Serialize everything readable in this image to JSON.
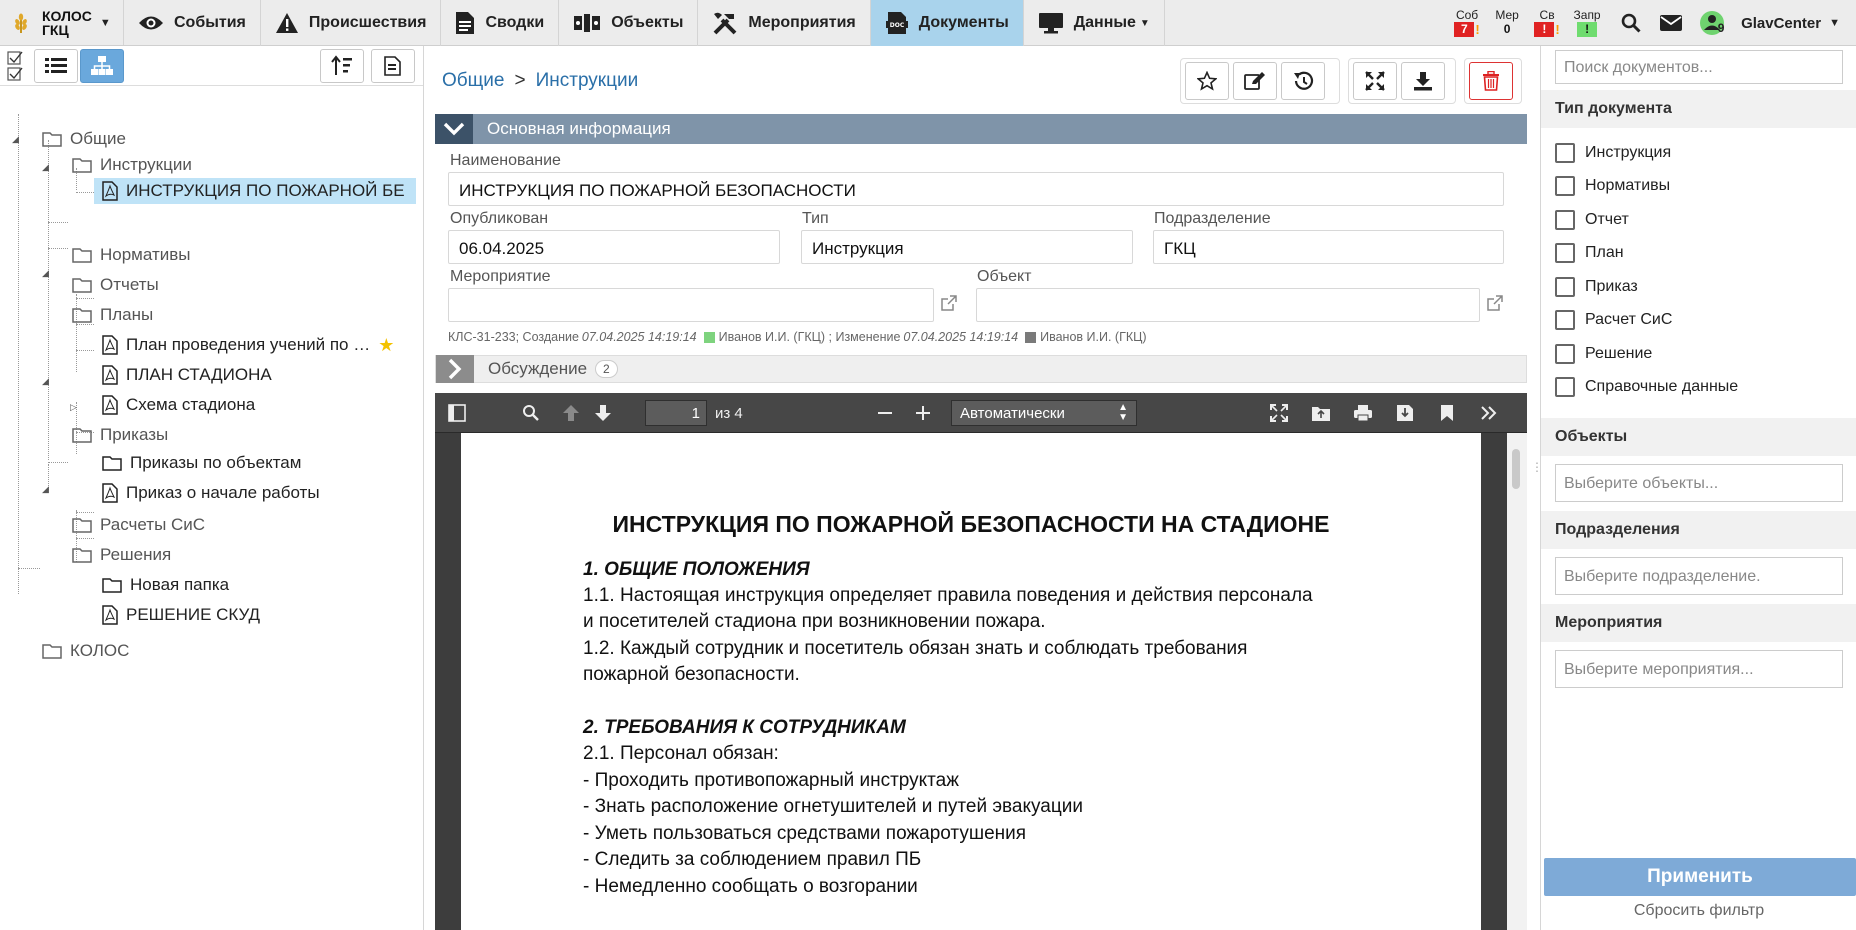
{
  "brand": {
    "line1": "КОЛОС",
    "line2": "ГКЦ"
  },
  "nav": [
    {
      "label": "События",
      "icon": "eye-icon"
    },
    {
      "label": "Происшествия",
      "icon": "warning-icon"
    },
    {
      "label": "Сводки",
      "icon": "document-icon"
    },
    {
      "label": "Объекты",
      "icon": "objects-icon"
    },
    {
      "label": "Мероприятия",
      "icon": "tools-icon"
    },
    {
      "label": "Документы",
      "icon": "doc-file-icon",
      "active": true
    },
    {
      "label": "Данные",
      "icon": "monitor-icon",
      "dropdown": true
    }
  ],
  "counters": [
    {
      "label": "Соб",
      "value": "7",
      "style": "red",
      "flag": "!"
    },
    {
      "label": "Мер",
      "value": "0",
      "style": "plain",
      "flag": ""
    },
    {
      "label": "Св",
      "value": "!",
      "style": "red",
      "flag": "!"
    },
    {
      "label": "Запр",
      "value": "!",
      "style": "green",
      "flag": ""
    }
  ],
  "user": {
    "name": "GlavCenter",
    "badge": "9"
  },
  "tree": {
    "nodes": [
      {
        "label": "Общие",
        "type": "folder"
      },
      {
        "label": "Инструкции",
        "type": "folder"
      },
      {
        "label": "ИНСТРУКЦИЯ ПО ПОЖАРНОЙ БЕ",
        "type": "pdf"
      },
      {
        "label": "Нормативы",
        "type": "folder"
      },
      {
        "label": "Отчеты",
        "type": "folder"
      },
      {
        "label": "Планы",
        "type": "folder"
      },
      {
        "label": "План проведения учений по …",
        "type": "pdf"
      },
      {
        "label": "ПЛАН СТАДИОНА",
        "type": "pdf"
      },
      {
        "label": "Схема стадиона",
        "type": "pdf"
      },
      {
        "label": "Приказы",
        "type": "folder"
      },
      {
        "label": "Приказы по объектам",
        "type": "folder"
      },
      {
        "label": "Приказ о начале работы",
        "type": "pdf"
      },
      {
        "label": "Расчеты СиС",
        "type": "folder"
      },
      {
        "label": "Решения",
        "type": "folder"
      },
      {
        "label": "Новая папка",
        "type": "folder"
      },
      {
        "label": "РЕШЕНИЕ СКУД",
        "type": "pdf"
      },
      {
        "label": "КОЛОС",
        "type": "folder"
      }
    ]
  },
  "breadcrumb": {
    "root": "Общие",
    "sep": ">",
    "current": "Инструкции"
  },
  "section": {
    "title": "Основная информация"
  },
  "form": {
    "name_label": "Наименование",
    "name_value": "ИНСТРУКЦИЯ ПО ПОЖАРНОЙ БЕЗОПАСНОСТИ",
    "published_label": "Опубликован",
    "published_value": "06.04.2025",
    "type_label": "Тип",
    "type_value": "Инструкция",
    "dept_label": "Подразделение",
    "dept_value": "ГКЦ",
    "event_label": "Мероприятие",
    "event_value": "",
    "object_label": "Объект",
    "object_value": ""
  },
  "meta": {
    "id": "КЛС-31-233; Создание",
    "created": "07.04.2025 14:19:14",
    "created_by": "Иванов И.И. (ГКЦ) ; Изменение",
    "modified": "07.04.2025 14:19:14",
    "modified_by": "Иванов И.И. (ГКЦ)",
    "created_color": "#7ed37e",
    "modified_color": "#7a7a7a"
  },
  "discussion": {
    "label": "Обсуждение",
    "count": "2"
  },
  "pdf": {
    "page": "1",
    "of": "из 4",
    "zoom": "Автоматически",
    "title": "ИНСТРУКЦИЯ ПО ПОЖАРНОЙ БЕЗОПАСНОСТИ НА СТАДИОНЕ",
    "lines": [
      {
        "text": "1. ОБЩИЕ ПОЛОЖЕНИЯ",
        "head": true
      },
      {
        "text": "1.1. Настоящая инструкция определяет правила поведения и действия персонала",
        "head": false
      },
      {
        "text": "и посетителей стадиона при возникновении пожара.",
        "head": false
      },
      {
        "text": "1.2. Каждый сотрудник и посетитель обязан знать и соблюдать требования",
        "head": false
      },
      {
        "text": "пожарной безопасности.",
        "head": false
      },
      {
        "text": "2. ТРЕБОВАНИЯ К СОТРУДНИКАМ",
        "head": true
      },
      {
        "text": "2.1. Персонал обязан:",
        "head": false
      },
      {
        "text": "- Проходить противопожарный инструктаж",
        "head": false
      },
      {
        "text": "- Знать расположение огнетушителей и путей эвакуации",
        "head": false
      },
      {
        "text": "- Уметь пользоваться средствами пожаротушения",
        "head": false
      },
      {
        "text": "- Следить за соблюдением правил ПБ",
        "head": false
      },
      {
        "text": "- Немедленно сообщать о возгорании",
        "head": false
      }
    ]
  },
  "filters": {
    "search_placeholder": "Поиск документов...",
    "doc_type_title": "Тип документа",
    "doc_types": [
      "Инструкция",
      "Нормативы",
      "Отчет",
      "План",
      "Приказ",
      "Расчет СиС",
      "Решение",
      "Справочные данные"
    ],
    "objects_title": "Объекты",
    "objects_placeholder": "Выберите объекты...",
    "depts_title": "Подразделения",
    "depts_placeholder": "Выберите подразделение.",
    "events_title": "Мероприятия",
    "events_placeholder": "Выберите мероприятия...",
    "apply": "Применить",
    "reset": "Сбросить фильтр"
  }
}
